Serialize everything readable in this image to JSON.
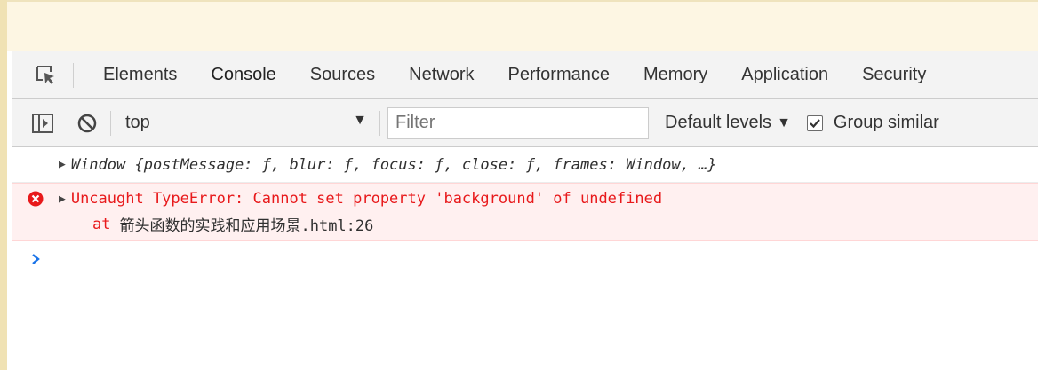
{
  "tabs": [
    {
      "label": "Elements"
    },
    {
      "label": "Console",
      "active": true
    },
    {
      "label": "Sources"
    },
    {
      "label": "Network"
    },
    {
      "label": "Performance"
    },
    {
      "label": "Memory"
    },
    {
      "label": "Application"
    },
    {
      "label": "Security"
    }
  ],
  "toolbar": {
    "context": "top",
    "filter_placeholder": "Filter",
    "levels_label": "Default levels",
    "group_similar_label": "Group similar",
    "group_similar_checked": true
  },
  "messages": {
    "info": "Window {postMessage: ƒ, blur: ƒ, focus: ƒ, close: ƒ, frames: Window, …}",
    "error_text": "Uncaught TypeError: Cannot set property 'background' of undefined",
    "error_stack_prefix": "at",
    "error_stack_link": "箭头函数的实践和应用场景.html:26"
  },
  "colors": {
    "accent": "#1a73e8",
    "error": "#e8191b",
    "error_bg": "#fff0f0",
    "prompt": "#1a73e8"
  },
  "icons": {
    "inspect": "inspect-element-icon",
    "sidebar": "show-sidebar-icon",
    "clear": "clear-console-icon",
    "error": "error-icon",
    "expand": "expand-triangle-icon",
    "prompt": "prompt-chevron-icon",
    "checkbox": "checkmark-icon"
  }
}
